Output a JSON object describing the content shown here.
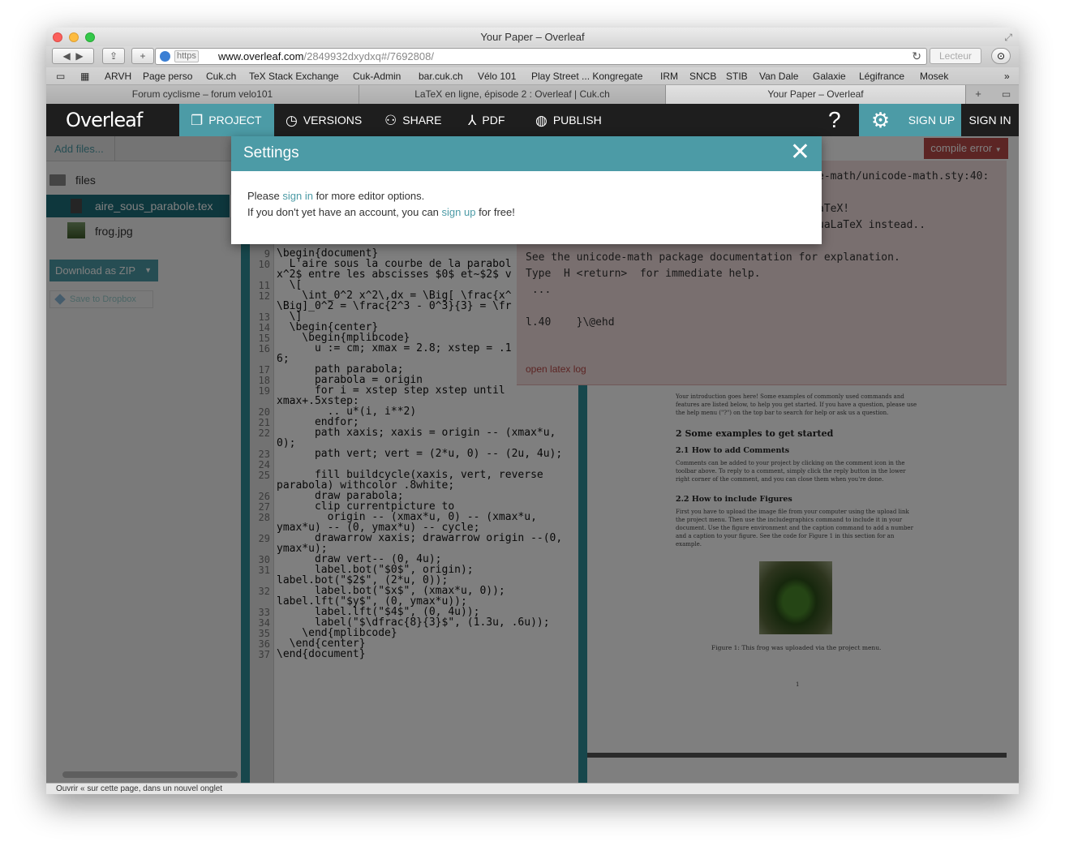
{
  "window": {
    "title": "Your Paper – Overleaf"
  },
  "browser": {
    "url_scheme": "https",
    "url_host": "www.overleaf.com",
    "url_path": "/2849932dxydxq#/7692808/",
    "reader_label": "Lecteur",
    "bookmarks": [
      "ARVH",
      "Page perso",
      "Cuk.ch",
      "TeX Stack Exchange",
      "Cuk-Admin",
      "bar.cuk.ch",
      "Vélo 101",
      "Play Street ... Kongregate",
      "IRM",
      "SNCB",
      "STIB",
      "Van Dale",
      "Galaxie",
      "Légifrance",
      "Mosek"
    ],
    "tabs": [
      "Forum cyclisme – forum velo101",
      "LaTeX en ligne, épisode 2 : Overleaf | Cuk.ch",
      "Your Paper – Overleaf"
    ],
    "status_text": "Ouvrir « sur cette page, dans un nouvel onglet"
  },
  "nav": {
    "logo": "Overleaf",
    "project": "PROJECT",
    "versions": "VERSIONS",
    "share": "SHARE",
    "pdf": "PDF",
    "publish": "PUBLISH",
    "help": "?",
    "signup": "SIGN UP",
    "signin": "SIGN IN"
  },
  "sidebar": {
    "add_files": "Add files...",
    "folder": "files",
    "files": [
      "aire_sous_parabole.tex",
      "frog.jpg"
    ],
    "download_zip": "Download as ZIP",
    "dropbox": "Save to Dropbox"
  },
  "editor": {
    "lines": [
      {
        "n": "9",
        "text": "\\begin{document}"
      },
      {
        "n": "10",
        "text": "  L'aire sous la courbe de la parabol"
      },
      {
        "n": "",
        "text": "x^2$ entre les abscisses $0$ et~$2$ v"
      },
      {
        "n": "11",
        "text": "  \\["
      },
      {
        "n": "12",
        "text": "    \\int_0^2 x^2\\,dx = \\Big[ \\frac{x^"
      },
      {
        "n": "",
        "text": "\\Big]_0^2 = \\frac{2^3 - 0^3}{3} = \\fr"
      },
      {
        "n": "13",
        "text": "  \\]"
      },
      {
        "n": "14",
        "text": "  \\begin{center}"
      },
      {
        "n": "15",
        "text": "    \\begin{mplibcode}"
      },
      {
        "n": "16",
        "text": "      u := cm; xmax = 2.8; xstep = .1"
      },
      {
        "n": "",
        "text": "6;"
      },
      {
        "n": "17",
        "text": "      path parabola;"
      },
      {
        "n": "18",
        "text": "      parabola = origin"
      },
      {
        "n": "19",
        "text": "      for i = xstep step xstep until"
      },
      {
        "n": "",
        "text": "xmax+.5xstep:"
      },
      {
        "n": "20",
        "text": "        .. u*(i, i**2)"
      },
      {
        "n": "21",
        "text": "      endfor;"
      },
      {
        "n": "22",
        "text": "      path xaxis; xaxis = origin -- (xmax*u,"
      },
      {
        "n": "",
        "text": "0);"
      },
      {
        "n": "23",
        "text": "      path vert; vert = (2*u, 0) -- (2u, 4u);"
      },
      {
        "n": "24",
        "text": ""
      },
      {
        "n": "25",
        "text": "      fill buildcycle(xaxis, vert, reverse"
      },
      {
        "n": "",
        "text": "parabola) withcolor .8white;"
      },
      {
        "n": "26",
        "text": "      draw parabola;"
      },
      {
        "n": "27",
        "text": "      clip currentpicture to"
      },
      {
        "n": "28",
        "text": "        origin -- (xmax*u, 0) -- (xmax*u,"
      },
      {
        "n": "",
        "text": "ymax*u) -- (0, ymax*u) -- cycle;"
      },
      {
        "n": "29",
        "text": "      drawarrow xaxis; drawarrow origin --(0,"
      },
      {
        "n": "",
        "text": "ymax*u);"
      },
      {
        "n": "30",
        "text": "      draw vert-- (0, 4u);"
      },
      {
        "n": "31",
        "text": "      label.bot(\"$0$\", origin);"
      },
      {
        "n": "",
        "text": "label.bot(\"$2$\", (2*u, 0));"
      },
      {
        "n": "32",
        "text": "      label.bot(\"$x$\", (xmax*u, 0));"
      },
      {
        "n": "",
        "text": "label.lft(\"$y$\", (0, ymax*u));"
      },
      {
        "n": "33",
        "text": "      label.lft(\"$4$\", (0, 4u));"
      },
      {
        "n": "34",
        "text": "      label(\"$\\dfrac{8}{3}$\", (1.3u, .6u));"
      },
      {
        "n": "35",
        "text": "    \\end{mplibcode}"
      },
      {
        "n": "36",
        "text": "  \\end{center}"
      },
      {
        "n": "37",
        "text": "\\end{document}"
      }
    ]
  },
  "pdf": {
    "compile_error": "compile error",
    "log_lines": [
      "e-math/unicode-math.sty:40:",
      "aTeX!",
      "uaLaTeX instead..",
      "See the unicode-math package documentation for explanation.",
      "Type  H <return>  for immediate help.",
      " ...",
      "l.40    }\\@ehd"
    ],
    "open_log": "open latex log",
    "intro": "Your introduction goes here! Some examples of commonly used commands and features are listed below, to help you get started. If you have a question, please use the help menu (\"?\") on the top bar to search for help or ask us a question.",
    "section": "2   Some examples to get started",
    "sub1": "2.1   How to add Comments",
    "sub1_text": "Comments can be added to your project by clicking on the comment icon in the toolbar above. To reply to a comment, simply click the reply button in the lower right corner of the comment, and you can close them when you're done.",
    "sub2": "2.2   How to include Figures",
    "sub2_text": "First you have to upload the image file from your computer using the upload link the project menu. Then use the includegraphics command to include it in your document. Use the figure environment and the caption command to add a number and a caption to your figure. See the code for Figure 1 in this section for an example.",
    "figure_caption": "Figure 1: This frog was uploaded via the project menu.",
    "page_number": "1"
  },
  "modal": {
    "title": "Settings",
    "close": "✕",
    "line1_pre": "Please ",
    "line1_link": "sign in",
    "line1_post": " for more editor options.",
    "line2_pre": "If you don't yet have an account, you can ",
    "line2_link": "sign up",
    "line2_post": " for free!"
  }
}
